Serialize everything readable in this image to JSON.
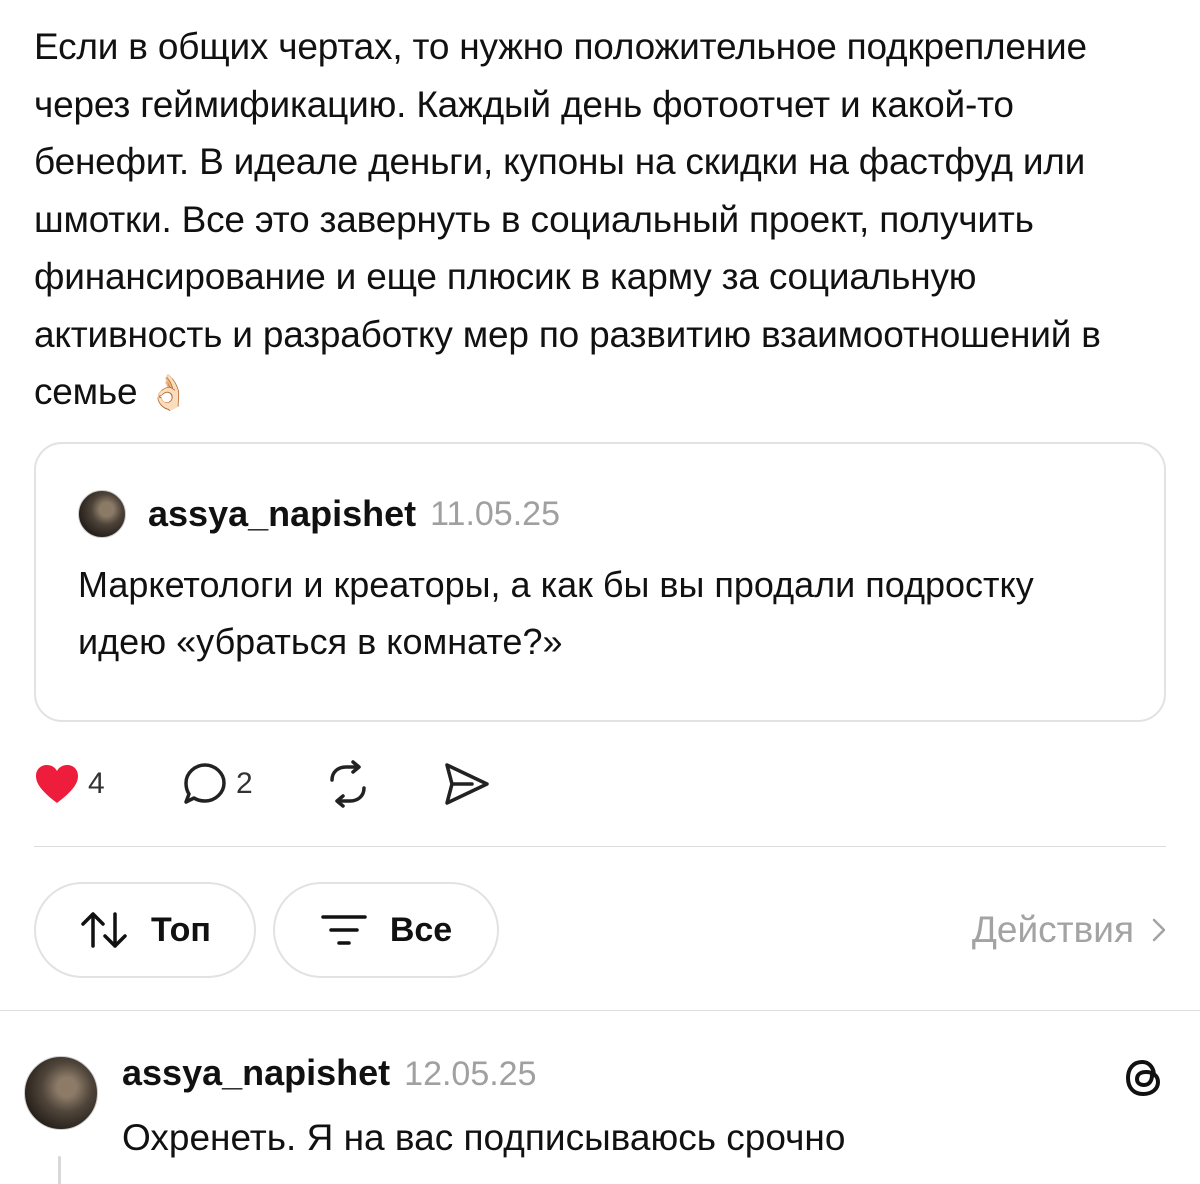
{
  "post": {
    "text": "Если в общих чертах, то нужно положительное подкрепление через геймификацию. Каждый день фотоотчет и какой-то бенефит. В идеале деньги, купоны на скидки на фастфуд или шмотки. Все это завернуть в социальный проект, получить финансирование и еще плюсик в карму за социальную активность и разработку мер по развитию взаимоотношений в семье",
    "emoji": "👌🏻"
  },
  "quote": {
    "username": "assya_napishet",
    "date": "11.05.25",
    "text": "Маркетологи и креаторы, а как бы вы продали подростку идею «убраться в комнате?»"
  },
  "actions": {
    "likes": "4",
    "replies": "2",
    "like_color": "#ee1d3b",
    "icons": [
      "heart-icon",
      "comment-icon",
      "repost-icon",
      "share-icon"
    ]
  },
  "filters": {
    "sort_label": "Топ",
    "filter_label": "Все",
    "activity_label": "Действия"
  },
  "comment": {
    "username": "assya_napishet",
    "date": "12.05.25",
    "text": "Охренеть. Я на вас подписываюсь срочно"
  }
}
